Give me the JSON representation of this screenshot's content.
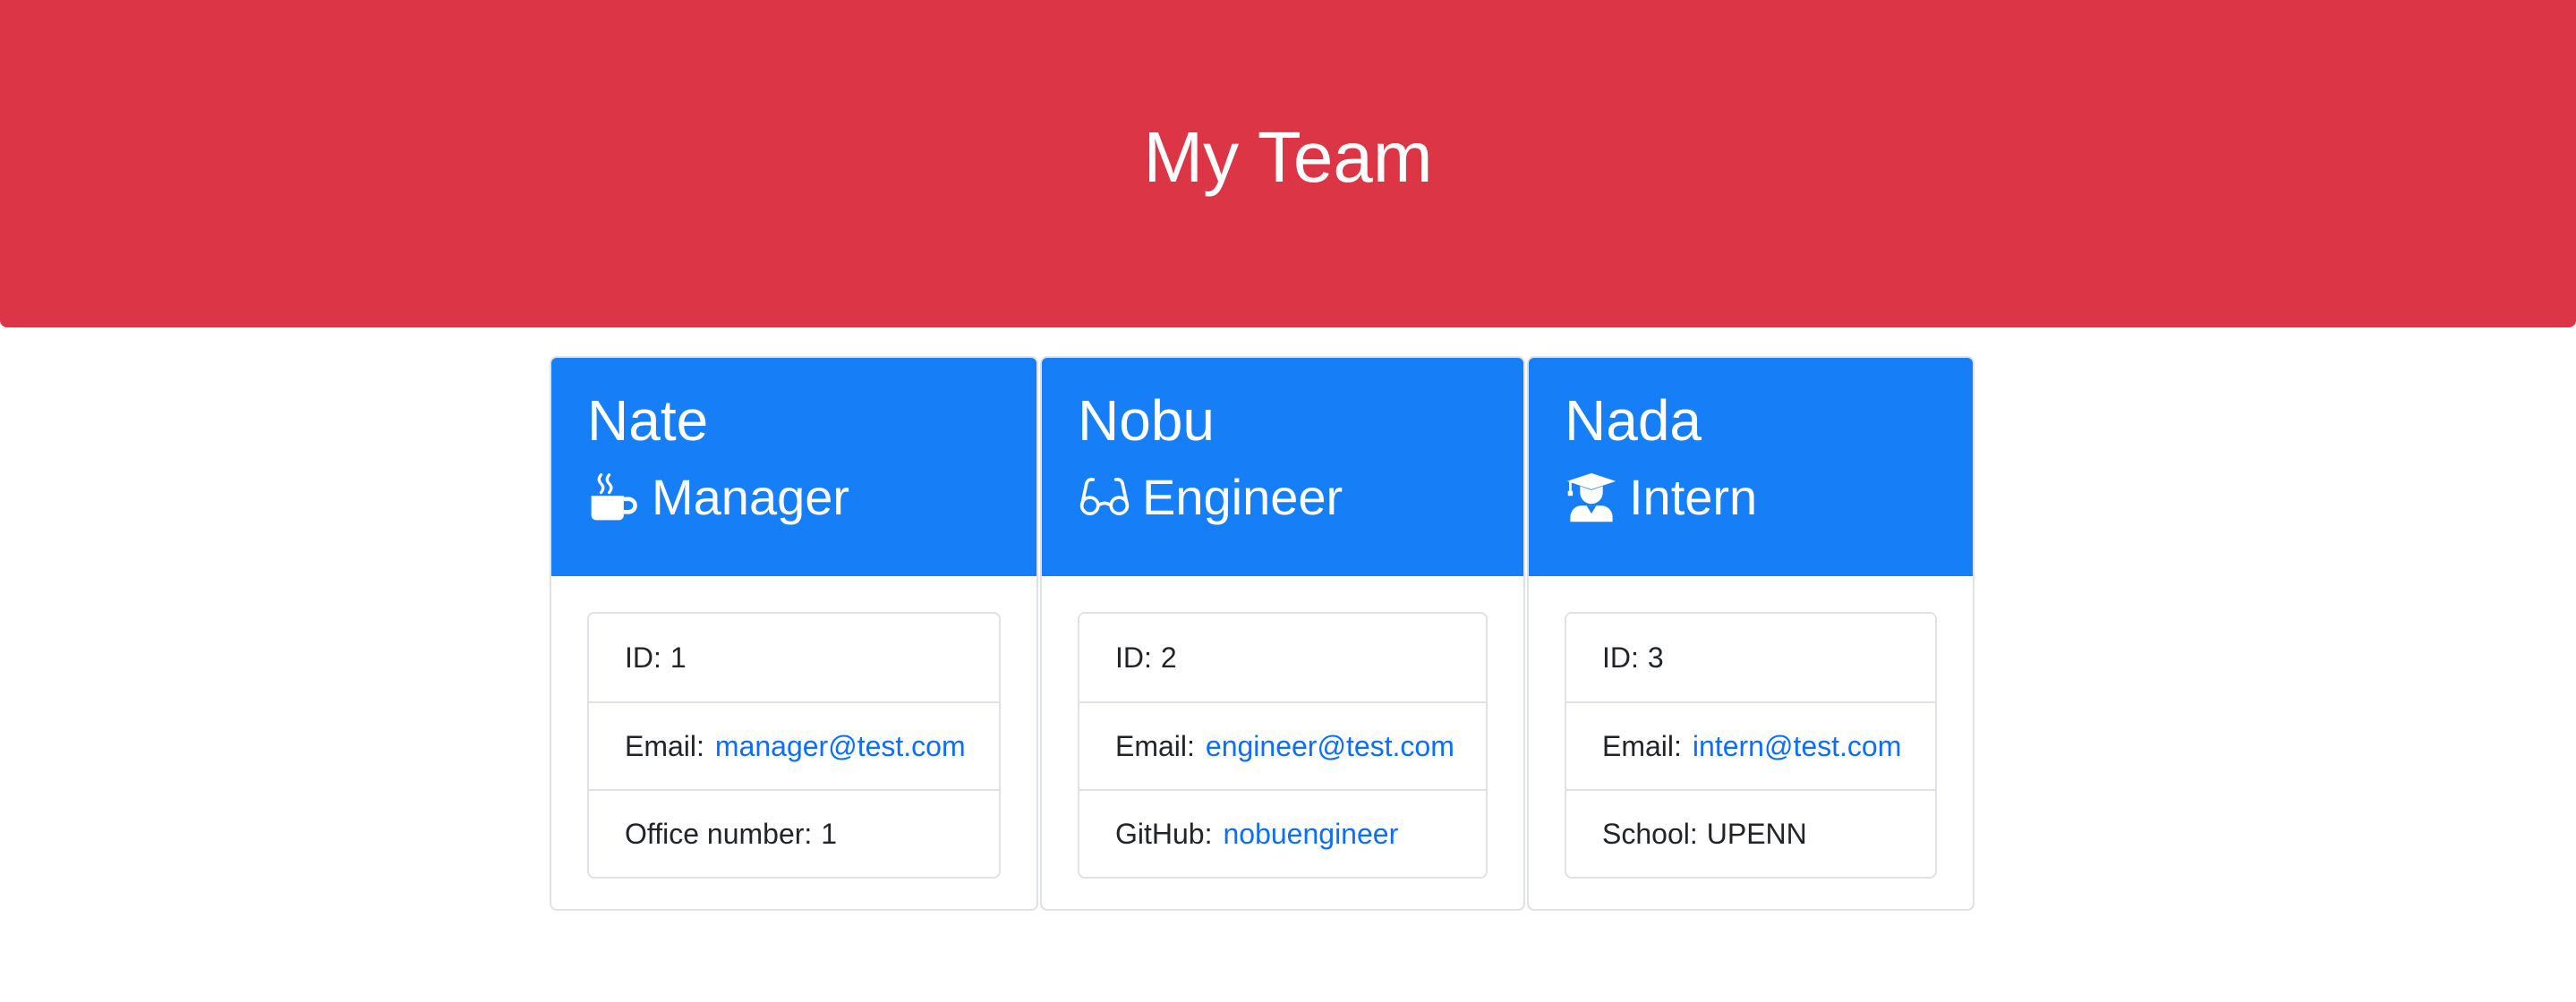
{
  "header": {
    "title": "My Team"
  },
  "colors": {
    "header_bg": "#dc3545",
    "card_header_bg": "#167ef7",
    "link": "#0d6efd"
  },
  "employees": [
    {
      "name": "Nate",
      "role": "Manager",
      "role_icon": "mug-hot-icon",
      "id_label": "ID:",
      "id_value": "1",
      "email_label": "Email:",
      "email": "manager@test.com",
      "extra_label": "Office number:",
      "extra_value": "1"
    },
    {
      "name": "Nobu",
      "role": "Engineer",
      "role_icon": "glasses-icon",
      "id_label": "ID:",
      "id_value": "2",
      "email_label": "Email:",
      "email": "engineer@test.com",
      "extra_label": "GitHub:",
      "extra_value": "nobuengineer"
    },
    {
      "name": "Nada",
      "role": "Intern",
      "role_icon": "user-graduate-icon",
      "id_label": "ID:",
      "id_value": "3",
      "email_label": "Email:",
      "email": "intern@test.com",
      "extra_label": "School:",
      "extra_value": "UPENN"
    }
  ]
}
